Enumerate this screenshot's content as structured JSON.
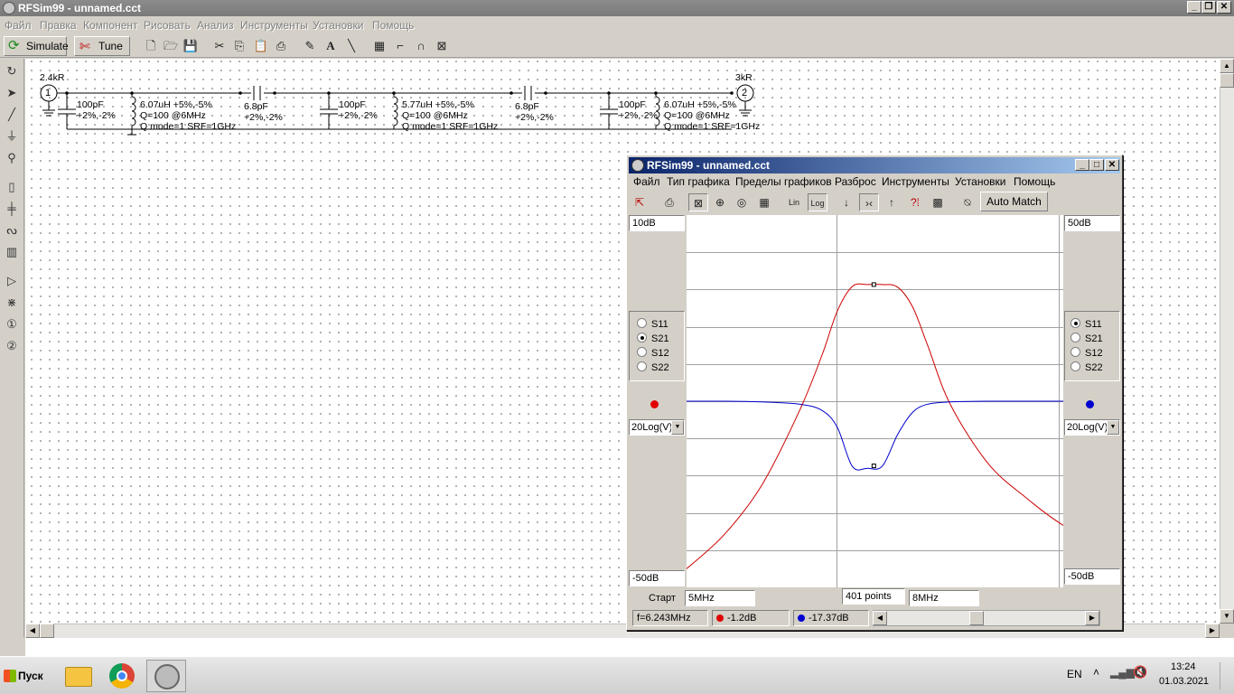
{
  "window": {
    "title": "RFSim99 - unnamed.cct"
  },
  "menu": [
    "Файл",
    "Правка",
    "Компонент",
    "Рисовать",
    "Анализ",
    "Инструменты",
    "Установки",
    "Помощь"
  ],
  "toolbar": {
    "simulate": "Simulate",
    "tune": "Tune"
  },
  "schematic": {
    "port1_res": "2.4kR",
    "port2_res": "3kR",
    "port1_num": "1",
    "port2_num": "2",
    "c1": [
      "100pF",
      "+2%,-2%"
    ],
    "l1": [
      "6.07uH  +5%,-5%",
      "Q=100 @6MHz",
      "Q mode=1 SRF=1GHz"
    ],
    "cs1": [
      "6.8pF",
      "+2%,-2%"
    ],
    "c2": [
      "100pF",
      "+2%,-2%"
    ],
    "l2": [
      "5.77uH  +5%,-5%",
      "Q=100 @6MHz",
      "Q mode=1 SRF=1GHz"
    ],
    "cs2": [
      "6.8pF",
      "+2%,-2%"
    ],
    "c3": [
      "100pF",
      "+2%,-2%"
    ],
    "l3": [
      "6.07uH  +5%,-5%",
      "Q=100 @6MHz",
      "Q mode=1 SRF=1GHz"
    ]
  },
  "graph": {
    "title": "RFSim99 - unnamed.cct",
    "menu": [
      "Файл",
      "Тип графика",
      "Пределы графиков",
      "Разброс",
      "Инструменты",
      "Установки",
      "Помощь"
    ],
    "auto_match": "Auto Match",
    "left_top": "10dB",
    "left_bottom": "-50dB",
    "right_top": "50dB",
    "right_bottom": "-50dB",
    "left_params": [
      "S11",
      "S21",
      "S12",
      "S22"
    ],
    "left_selected": "S21",
    "right_params": [
      "S11",
      "S21",
      "S12",
      "S22"
    ],
    "right_selected": "S11",
    "left_scale": "20Log(V)",
    "right_scale": "20Log(V)",
    "start_label": "Старт",
    "start_value": "5MHz",
    "points": "401 points",
    "stop_value": "8MHz",
    "freq_readout": "f=6.243MHz",
    "red_readout": "-1.2dB",
    "blue_readout": "-17.37dB",
    "red_color": "#cc0000",
    "blue_color": "#0000cc"
  },
  "chart_data": {
    "type": "line",
    "x_range": [
      "5MHz",
      "8MHz"
    ],
    "left_ylim": [
      -50,
      10
    ],
    "right_ylim": [
      -50,
      50
    ],
    "x_mhz": [
      5.0,
      5.25,
      5.5,
      5.75,
      5.9,
      6.0,
      6.1,
      6.2,
      6.3,
      6.4,
      6.5,
      6.6,
      6.75,
      7.0,
      7.25,
      7.5,
      7.75,
      8.0
    ],
    "series": [
      {
        "name": "S21",
        "axis": "left",
        "color": "#cc0000",
        "values": [
          -47.0,
          -41.5,
          -33.5,
          -21.5,
          -12.5,
          -5.5,
          -1.5,
          -1.2,
          -1.2,
          -1.6,
          -4.8,
          -11.0,
          -20.5,
          -30.0,
          -35.5,
          -40.0,
          -43.0,
          -46.0
        ]
      },
      {
        "name": "S11",
        "axis": "right",
        "color": "#0000cc",
        "values": [
          0,
          0,
          -0.2,
          -0.8,
          -2.5,
          -7.0,
          -17.5,
          -18.0,
          -17.4,
          -9.0,
          -3.0,
          -0.8,
          -0.2,
          0,
          0,
          0,
          0,
          0
        ]
      }
    ],
    "grid": true
  },
  "taskbar": {
    "start": "Пуск",
    "lang": "EN",
    "time": "13:24",
    "date": "01.03.2021"
  }
}
